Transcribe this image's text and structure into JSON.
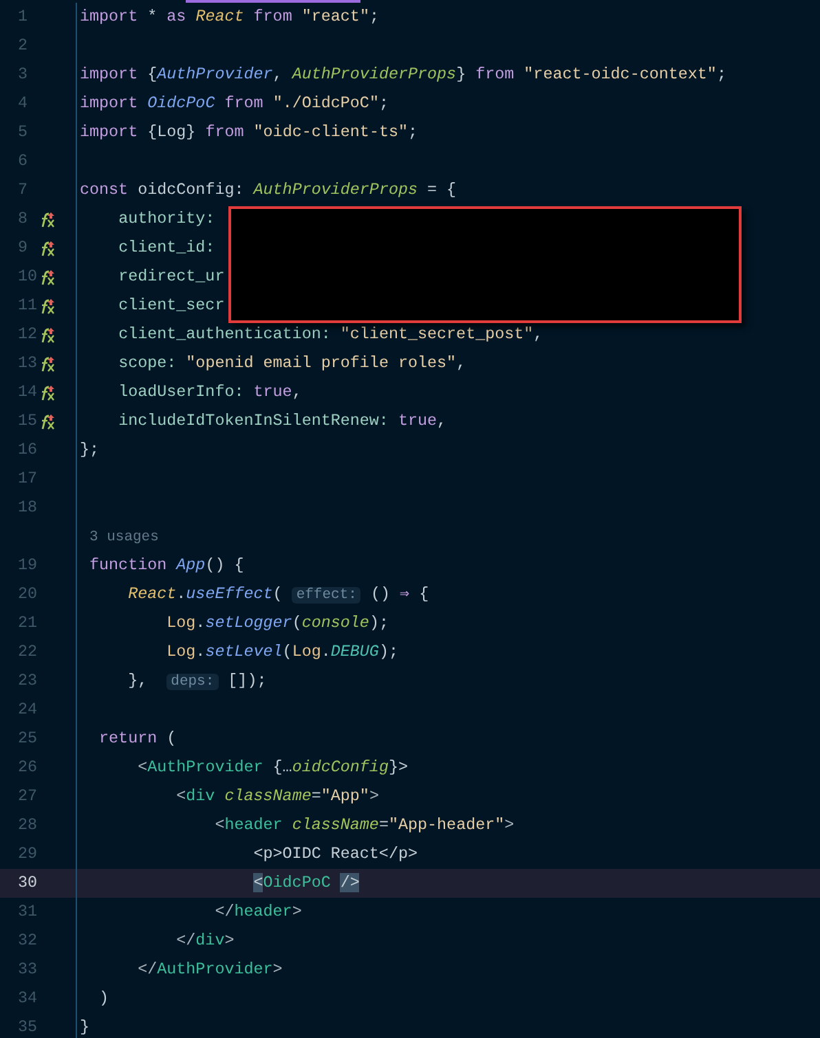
{
  "editor": {
    "lines": [
      {
        "kind": "code",
        "number": "1",
        "icon": false,
        "current": false,
        "tokens": [
          {
            "text": "import",
            "kind": "kw"
          },
          {
            "text": " * ",
            "kind": "plain"
          },
          {
            "text": "as",
            "kind": "kw"
          },
          {
            "text": " React",
            "kind": "ns"
          },
          {
            "text": " from",
            "kind": "kw"
          },
          {
            "text": " \"react\"",
            "kind": "str"
          },
          {
            "text": ";",
            "kind": "plain"
          }
        ]
      },
      {
        "kind": "code",
        "number": "2",
        "icon": false,
        "current": false
      },
      {
        "kind": "code",
        "number": "3",
        "icon": false,
        "current": false,
        "tokens": [
          {
            "text": "import",
            "kind": "kw"
          },
          {
            "text": " {",
            "kind": "plain"
          },
          {
            "text": "AuthProvider",
            "kind": "fn"
          },
          {
            "text": ", ",
            "kind": "plain"
          },
          {
            "text": "AuthProviderProps",
            "kind": "type"
          },
          {
            "text": "} ",
            "kind": "plain"
          },
          {
            "text": "from",
            "kind": "kw"
          },
          {
            "text": " \"react-oidc-context\"",
            "kind": "str"
          },
          {
            "text": ";",
            "kind": "plain"
          }
        ]
      },
      {
        "kind": "code",
        "number": "4",
        "icon": false,
        "current": false,
        "tokens": [
          {
            "text": "import",
            "kind": "kw"
          },
          {
            "text": " OidcPoC",
            "kind": "fn"
          },
          {
            "text": " from",
            "kind": "kw"
          },
          {
            "text": " \"./OidcPoC\"",
            "kind": "str"
          },
          {
            "text": ";",
            "kind": "plain"
          }
        ]
      },
      {
        "kind": "code",
        "number": "5",
        "icon": false,
        "current": false,
        "tokens": [
          {
            "text": "import",
            "kind": "kw"
          },
          {
            "text": " {Log} ",
            "kind": "plain"
          },
          {
            "text": "from",
            "kind": "kw"
          },
          {
            "text": " \"oidc-client-ts\"",
            "kind": "str"
          },
          {
            "text": ";",
            "kind": "plain"
          }
        ]
      },
      {
        "kind": "code",
        "number": "6",
        "icon": false,
        "current": false
      },
      {
        "kind": "code",
        "number": "7",
        "icon": false,
        "current": false,
        "tokens": [
          {
            "text": "const",
            "kind": "kw"
          },
          {
            "text": " oidcConfig: ",
            "kind": "plain"
          },
          {
            "text": "AuthProviderProps",
            "kind": "type"
          },
          {
            "text": " = {",
            "kind": "plain"
          }
        ]
      },
      {
        "kind": "code",
        "number": "8",
        "icon": true,
        "current": false,
        "tokens": [
          {
            "text": "    authority:",
            "kind": "prop"
          }
        ]
      },
      {
        "kind": "code",
        "number": "9",
        "icon": true,
        "current": false,
        "tokens": [
          {
            "text": "    client_id:",
            "kind": "prop"
          }
        ]
      },
      {
        "kind": "code",
        "number": "10",
        "icon": true,
        "current": false,
        "tokens": [
          {
            "text": "    redirect_ur",
            "kind": "prop"
          }
        ]
      },
      {
        "kind": "code",
        "number": "11",
        "icon": true,
        "current": false,
        "tokens": [
          {
            "text": "    client_secr",
            "kind": "prop"
          }
        ]
      },
      {
        "kind": "code",
        "number": "12",
        "icon": true,
        "current": false,
        "tokens": [
          {
            "text": "    client_authentication: ",
            "kind": "prop"
          },
          {
            "text": "\"client_secret_post\"",
            "kind": "str"
          },
          {
            "text": ",",
            "kind": "plain"
          }
        ]
      },
      {
        "kind": "code",
        "number": "13",
        "icon": true,
        "current": false,
        "tokens": [
          {
            "text": "    scope: ",
            "kind": "prop"
          },
          {
            "text": "\"openid email profile roles\"",
            "kind": "str"
          },
          {
            "text": ",",
            "kind": "plain"
          }
        ]
      },
      {
        "kind": "code",
        "number": "14",
        "icon": true,
        "current": false,
        "tokens": [
          {
            "text": "    loadUserInfo: ",
            "kind": "prop"
          },
          {
            "text": "true",
            "kind": "kw"
          },
          {
            "text": ",",
            "kind": "plain"
          }
        ]
      },
      {
        "kind": "code",
        "number": "15",
        "icon": true,
        "current": false,
        "tokens": [
          {
            "text": "    includeIdTokenInSilentRenew: ",
            "kind": "prop"
          },
          {
            "text": "true",
            "kind": "kw"
          },
          {
            "text": ",",
            "kind": "plain"
          }
        ]
      },
      {
        "kind": "code",
        "number": "16",
        "icon": false,
        "current": false,
        "tokens": [
          {
            "text": "};",
            "kind": "plain"
          }
        ]
      },
      {
        "kind": "code",
        "number": "17",
        "icon": false,
        "current": false
      },
      {
        "kind": "code",
        "number": "18",
        "icon": false,
        "current": false
      },
      {
        "kind": "usages",
        "text": "3 usages"
      },
      {
        "kind": "code",
        "number": "19",
        "icon": false,
        "current": false,
        "tokens": [
          {
            "text": " function",
            "kind": "kw"
          },
          {
            "text": " App",
            "kind": "fn"
          },
          {
            "text": "() {",
            "kind": "plain"
          }
        ]
      },
      {
        "kind": "code",
        "number": "20",
        "icon": false,
        "current": false,
        "tokens": [
          {
            "text": "     React",
            "kind": "ns"
          },
          {
            "text": ".",
            "kind": "plain"
          },
          {
            "text": "useEffect",
            "kind": "fn"
          },
          {
            "text": "( ",
            "kind": "plain"
          },
          {
            "text": "effect:",
            "kind": "hint"
          },
          {
            "text": " () ",
            "kind": "plain"
          },
          {
            "text": "⇒",
            "kind": "kw"
          },
          {
            "text": " {",
            "kind": "plain"
          }
        ]
      },
      {
        "kind": "code",
        "number": "21",
        "icon": false,
        "current": false,
        "tokens": [
          {
            "text": "         Log",
            "kind": "cls"
          },
          {
            "text": ".",
            "kind": "plain"
          },
          {
            "text": "setLogger",
            "kind": "fn"
          },
          {
            "text": "(",
            "kind": "plain"
          },
          {
            "text": "console",
            "kind": "type"
          },
          {
            "text": ");",
            "kind": "plain"
          }
        ]
      },
      {
        "kind": "code",
        "number": "22",
        "icon": false,
        "current": false,
        "tokens": [
          {
            "text": "         Log",
            "kind": "cls"
          },
          {
            "text": ".",
            "kind": "plain"
          },
          {
            "text": "setLevel",
            "kind": "fn"
          },
          {
            "text": "(",
            "kind": "plain"
          },
          {
            "text": "Log",
            "kind": "cls"
          },
          {
            "text": ".",
            "kind": "plain"
          },
          {
            "text": "DEBUG",
            "kind": "const"
          },
          {
            "text": ");",
            "kind": "plain"
          }
        ]
      },
      {
        "kind": "code",
        "number": "23",
        "icon": false,
        "current": false,
        "tokens": [
          {
            "text": "     },  ",
            "kind": "plain"
          },
          {
            "text": "deps:",
            "kind": "hint"
          },
          {
            "text": " []);",
            "kind": "plain"
          }
        ]
      },
      {
        "kind": "code",
        "number": "24",
        "icon": false,
        "current": false
      },
      {
        "kind": "code",
        "number": "25",
        "icon": false,
        "current": false,
        "tokens": [
          {
            "text": "  return",
            "kind": "kw"
          },
          {
            "text": " (",
            "kind": "plain"
          }
        ]
      },
      {
        "kind": "code",
        "number": "26",
        "icon": false,
        "current": false,
        "tokens": [
          {
            "text": "      <",
            "kind": "punct"
          },
          {
            "text": "AuthProvider",
            "kind": "tag"
          },
          {
            "text": " {…",
            "kind": "plain"
          },
          {
            "text": "oidcConfig",
            "kind": "type"
          },
          {
            "text": "}>",
            "kind": "plain"
          }
        ]
      },
      {
        "kind": "code",
        "number": "27",
        "icon": false,
        "current": false,
        "tokens": [
          {
            "text": "          <",
            "kind": "punct"
          },
          {
            "text": "div",
            "kind": "tag"
          },
          {
            "text": " className",
            "kind": "attr"
          },
          {
            "text": "=",
            "kind": "plain"
          },
          {
            "text": "\"App\"",
            "kind": "str"
          },
          {
            "text": ">",
            "kind": "punct"
          }
        ]
      },
      {
        "kind": "code",
        "number": "28",
        "icon": false,
        "current": false,
        "tokens": [
          {
            "text": "              <",
            "kind": "punct"
          },
          {
            "text": "header",
            "kind": "tag"
          },
          {
            "text": " className",
            "kind": "attr"
          },
          {
            "text": "=",
            "kind": "plain"
          },
          {
            "text": "\"App-header\"",
            "kind": "str"
          },
          {
            "text": ">",
            "kind": "punct"
          }
        ]
      },
      {
        "kind": "code",
        "number": "29",
        "icon": false,
        "current": false,
        "tokens": [
          {
            "text": "                  <p>OIDC React</p>",
            "kind": "plain"
          }
        ]
      },
      {
        "kind": "code",
        "number": "30",
        "icon": false,
        "current": true,
        "tokens": [
          {
            "text": "                  <",
            "kind": "match"
          },
          {
            "text": "OidcPoC",
            "kind": "tag"
          },
          {
            "text": " />",
            "kind": "match"
          }
        ]
      },
      {
        "kind": "code",
        "number": "31",
        "icon": false,
        "current": false,
        "tokens": [
          {
            "text": "              </",
            "kind": "punct"
          },
          {
            "text": "header",
            "kind": "tag"
          },
          {
            "text": ">",
            "kind": "punct"
          }
        ]
      },
      {
        "kind": "code",
        "number": "32",
        "icon": false,
        "current": false,
        "tokens": [
          {
            "text": "          </",
            "kind": "punct"
          },
          {
            "text": "div",
            "kind": "tag"
          },
          {
            "text": ">",
            "kind": "punct"
          }
        ]
      },
      {
        "kind": "code",
        "number": "33",
        "icon": false,
        "current": false,
        "tokens": [
          {
            "text": "      </",
            "kind": "punct"
          },
          {
            "text": "AuthProvider",
            "kind": "tag"
          },
          {
            "text": ">",
            "kind": "punct"
          }
        ]
      },
      {
        "kind": "code",
        "number": "34",
        "icon": false,
        "current": false,
        "tokens": [
          {
            "text": "  )",
            "kind": "plain"
          }
        ]
      },
      {
        "kind": "code",
        "number": "35",
        "icon": false,
        "current": false,
        "tokens": [
          {
            "text": "}",
            "kind": "plain"
          }
        ]
      }
    ]
  }
}
